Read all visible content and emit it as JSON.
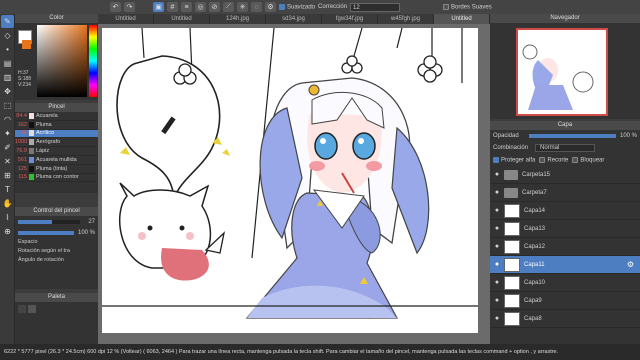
{
  "toolbar": {
    "suavizado_label": "Suavizado",
    "correccion_label": "Corrección",
    "correccion_value": "12",
    "bordes_label": "Bordes Suaves"
  },
  "tabs": [
    "Untitled",
    "Untitled",
    "124h.jpg",
    "sd34.jpg",
    "fgw34f.jpg",
    "w45fgh.jpg",
    "Untitled"
  ],
  "color_panel": {
    "title": "Color",
    "h": "H:37",
    "s": "S:188",
    "v": "V:234",
    "fg": "#ffffff",
    "bg": "#e8741c"
  },
  "pincel_panel": {
    "title": "Pincel",
    "brushes": [
      {
        "size": "84.4",
        "name": "Acuarela",
        "color": "#f0e0e0"
      },
      {
        "size": "162",
        "name": "Pluma",
        "color": "#111111"
      },
      {
        "size": "46",
        "name": "Acrílico",
        "color": "#dddddd",
        "active": true
      },
      {
        "size": "1000",
        "name": "Aerógrafo",
        "color": "#aaaaaa"
      },
      {
        "size": "76.9",
        "name": "Lápiz",
        "color": "#777777"
      },
      {
        "size": "561",
        "name": "Acuarela mullida",
        "color": "#6a8fd8"
      },
      {
        "size": "125",
        "name": "Pluma (tinta)",
        "color": "#111111"
      },
      {
        "size": "115",
        "name": "Pluma con contor",
        "color": "#2fbf2f"
      }
    ]
  },
  "control_panel": {
    "title": "Control del pincel",
    "size_value": "27",
    "opacity_value": "100 %",
    "options": [
      "Espacio",
      "Rotación según el tra",
      "Ángulo de rotación"
    ]
  },
  "paleta_panel": {
    "title": "Paleta"
  },
  "navigator": {
    "title": "Navegador"
  },
  "capa_panel": {
    "title": "Capa",
    "opacity_label": "Opacidad",
    "opacity_value": "100 %",
    "blend_label": "Combinación",
    "blend_value": "Normal",
    "protect_label": "Proteger alfa",
    "clip_label": "Recorte",
    "lock_label": "Bloquear",
    "layers": [
      {
        "name": "Carpeta15",
        "type": "folder"
      },
      {
        "name": "Carpeta7",
        "type": "folder"
      },
      {
        "name": "Capa14",
        "type": "layer"
      },
      {
        "name": "Capa13",
        "type": "layer"
      },
      {
        "name": "Capa12",
        "type": "layer"
      },
      {
        "name": "Capa11",
        "type": "layer",
        "selected": true
      },
      {
        "name": "Capa10",
        "type": "layer"
      },
      {
        "name": "Capa9",
        "type": "layer"
      },
      {
        "name": "Capa8",
        "type": "layer"
      }
    ]
  },
  "status": {
    "text": "6222 * 5777 pixel  (26.3 * 24.5cm)  600 dpi  12 % (Voltear)  ( 6063, 2464 )  Para trazar una línea recta, mantenga pulsada la tecla shift. Para cambiar el tamaño del pincel, mantenga pulsada las teclas command + option , y arrastre."
  }
}
